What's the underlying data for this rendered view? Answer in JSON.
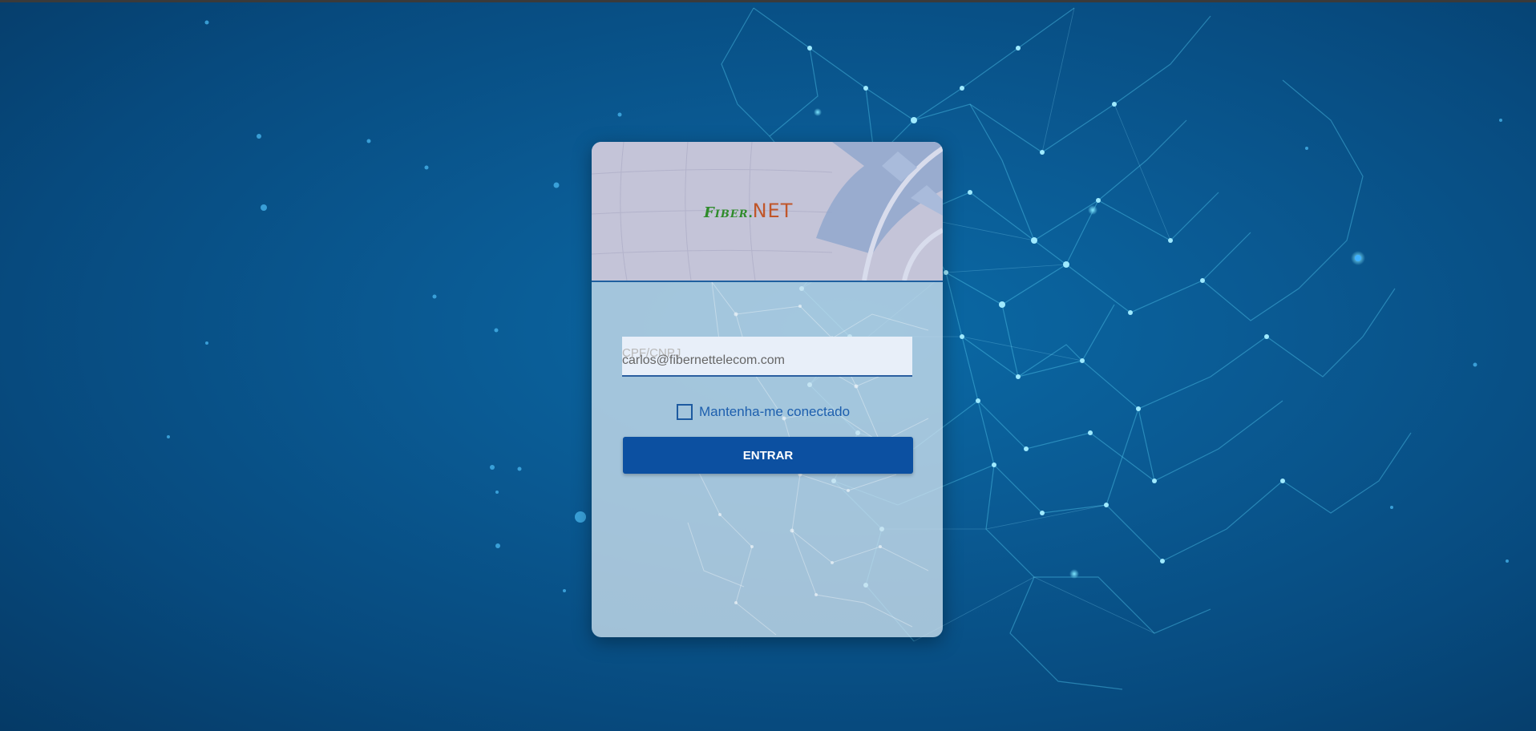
{
  "brand": {
    "logo_part1": "Fiber",
    "logo_dot": ".",
    "logo_part2": "NET"
  },
  "login": {
    "field_label": "CPF/CNPJ",
    "field_value": "carlos@fibernettelecom.com",
    "remember_label": "Mantenha-me conectado",
    "remember_checked": false,
    "submit_label": "ENTRAR"
  },
  "colors": {
    "background": "#0a5a93",
    "button": "#0c50a1",
    "accent": "#1d5fae",
    "logo_green": "#2e8b2a",
    "logo_orange": "#c0562a"
  }
}
